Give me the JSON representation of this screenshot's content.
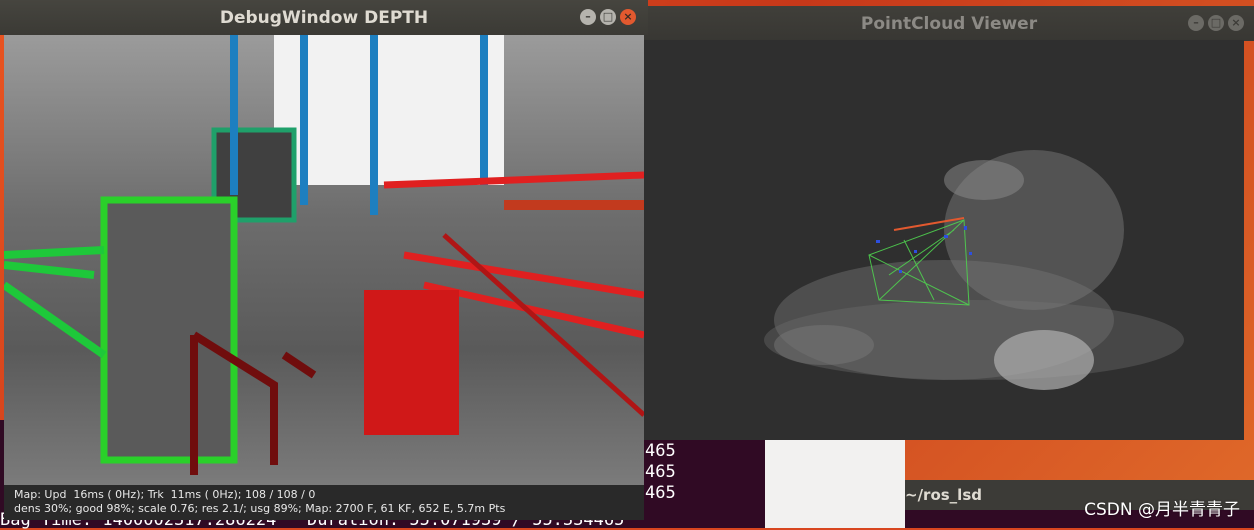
{
  "windows": {
    "depth": {
      "title": "DebugWindow DEPTH",
      "status_line_1": "Map: Upd  16ms ( 0Hz); Trk  11ms ( 0Hz); 108 / 108 / 0",
      "status_line_2": "dens 30%; good 98%; scale 0.76; res 2.1/; usg 89%; Map: 2700 F, 61 KF, 652 E, 5.7m Pts"
    },
    "pointcloud": {
      "title": "PointCloud Viewer"
    }
  },
  "terminal": {
    "lines": [
      "465",
      "465",
      "465",
      "465"
    ],
    "bottom": "Bag Time: 1400002317.286224   Duration: 55.071939 / 55.334465"
  },
  "terminal2": {
    "title": "~/ros_lsd"
  },
  "window_buttons": {
    "min": "–",
    "max": "□",
    "close": "×"
  },
  "watermark": "CSDN @月半青青子",
  "colors": {
    "desktop": "#e95420",
    "terminal": "#300a24",
    "titlebar": "#3c3b37"
  }
}
